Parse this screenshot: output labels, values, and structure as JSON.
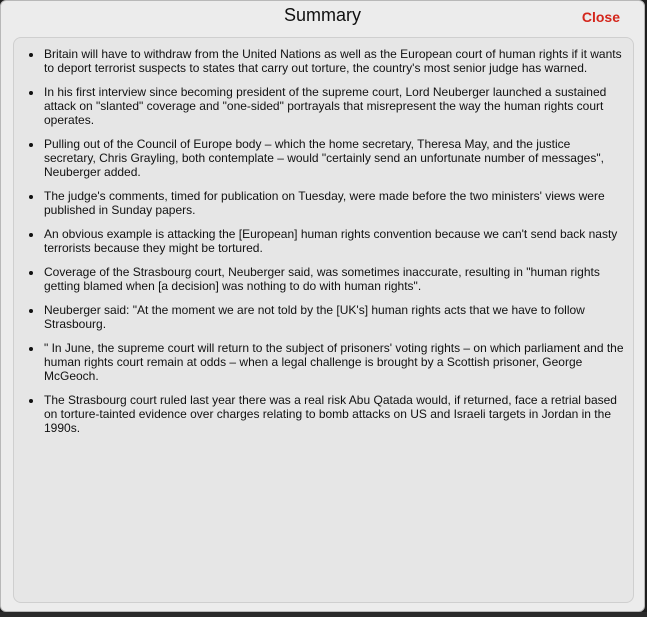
{
  "dialog": {
    "title": "Summary",
    "close_label": "Close"
  },
  "summary": {
    "items": [
      "Britain will have to withdraw from the United Nations as well as the European court of human rights if it wants to deport terrorist suspects to states that carry out torture, the country's most senior judge has warned.",
      "In his first interview since becoming president of the supreme court, Lord Neuberger launched a sustained attack on \"slanted\" coverage and \"one-sided\" portrayals that misrepresent the way the human rights court operates.",
      "Pulling out of the Council of Europe body – which the home secretary, Theresa May, and the justice secretary, Chris Grayling, both contemplate – would \"certainly send an unfortunate number of messages\", Neuberger added.",
      "The judge's comments, timed for publication on Tuesday, were made before the two ministers' views were published in Sunday papers.",
      "An obvious example is attacking the [European] human rights convention because we can't send back nasty terrorists because they might be tortured.",
      "Coverage of the Strasbourg court, Neuberger said, was sometimes inaccurate, resulting in \"human rights getting blamed when [a decision] was nothing to do with human rights\".",
      "Neuberger said: \"At the moment we are not told by the [UK's] human rights acts that we have to follow Strasbourg.",
      "\" In June, the supreme court will return to the subject of prisoners' voting rights – on which parliament and the human rights court remain at odds – when a legal challenge is brought by a Scottish prisoner, George McGeoch.",
      "The Strasbourg court ruled last year there was a real risk Abu Qatada would, if returned, face a retrial based on torture-tainted evidence over charges relating to bomb attacks on US and Israeli targets in Jordan in the 1990s."
    ]
  }
}
